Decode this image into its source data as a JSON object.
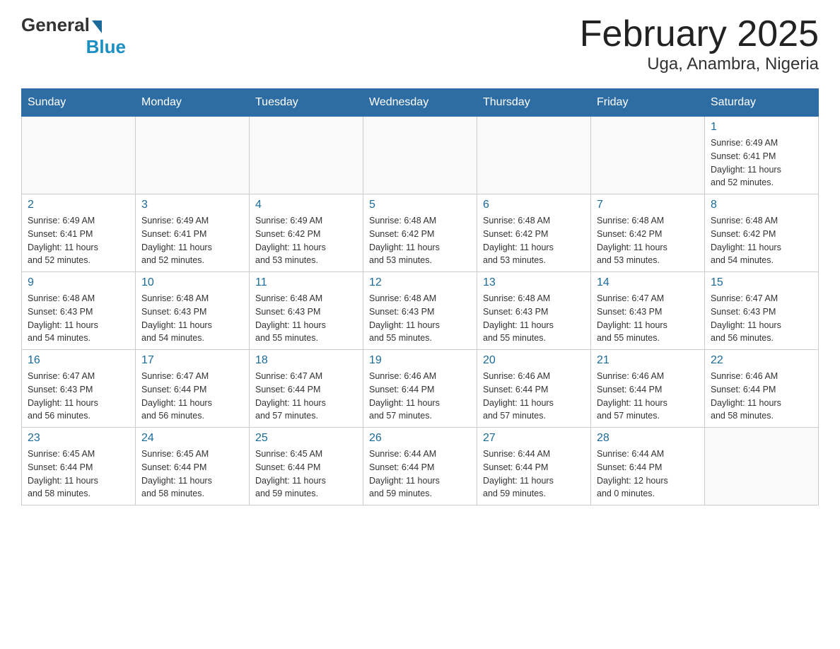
{
  "logo": {
    "general": "General",
    "blue": "Blue",
    "subtitle": "Blue"
  },
  "title": "February 2025",
  "location": "Uga, Anambra, Nigeria",
  "days_of_week": [
    "Sunday",
    "Monday",
    "Tuesday",
    "Wednesday",
    "Thursday",
    "Friday",
    "Saturday"
  ],
  "weeks": [
    [
      {
        "day": "",
        "info": ""
      },
      {
        "day": "",
        "info": ""
      },
      {
        "day": "",
        "info": ""
      },
      {
        "day": "",
        "info": ""
      },
      {
        "day": "",
        "info": ""
      },
      {
        "day": "",
        "info": ""
      },
      {
        "day": "1",
        "info": "Sunrise: 6:49 AM\nSunset: 6:41 PM\nDaylight: 11 hours\nand 52 minutes."
      }
    ],
    [
      {
        "day": "2",
        "info": "Sunrise: 6:49 AM\nSunset: 6:41 PM\nDaylight: 11 hours\nand 52 minutes."
      },
      {
        "day": "3",
        "info": "Sunrise: 6:49 AM\nSunset: 6:41 PM\nDaylight: 11 hours\nand 52 minutes."
      },
      {
        "day": "4",
        "info": "Sunrise: 6:49 AM\nSunset: 6:42 PM\nDaylight: 11 hours\nand 53 minutes."
      },
      {
        "day": "5",
        "info": "Sunrise: 6:48 AM\nSunset: 6:42 PM\nDaylight: 11 hours\nand 53 minutes."
      },
      {
        "day": "6",
        "info": "Sunrise: 6:48 AM\nSunset: 6:42 PM\nDaylight: 11 hours\nand 53 minutes."
      },
      {
        "day": "7",
        "info": "Sunrise: 6:48 AM\nSunset: 6:42 PM\nDaylight: 11 hours\nand 53 minutes."
      },
      {
        "day": "8",
        "info": "Sunrise: 6:48 AM\nSunset: 6:42 PM\nDaylight: 11 hours\nand 54 minutes."
      }
    ],
    [
      {
        "day": "9",
        "info": "Sunrise: 6:48 AM\nSunset: 6:43 PM\nDaylight: 11 hours\nand 54 minutes."
      },
      {
        "day": "10",
        "info": "Sunrise: 6:48 AM\nSunset: 6:43 PM\nDaylight: 11 hours\nand 54 minutes."
      },
      {
        "day": "11",
        "info": "Sunrise: 6:48 AM\nSunset: 6:43 PM\nDaylight: 11 hours\nand 55 minutes."
      },
      {
        "day": "12",
        "info": "Sunrise: 6:48 AM\nSunset: 6:43 PM\nDaylight: 11 hours\nand 55 minutes."
      },
      {
        "day": "13",
        "info": "Sunrise: 6:48 AM\nSunset: 6:43 PM\nDaylight: 11 hours\nand 55 minutes."
      },
      {
        "day": "14",
        "info": "Sunrise: 6:47 AM\nSunset: 6:43 PM\nDaylight: 11 hours\nand 55 minutes."
      },
      {
        "day": "15",
        "info": "Sunrise: 6:47 AM\nSunset: 6:43 PM\nDaylight: 11 hours\nand 56 minutes."
      }
    ],
    [
      {
        "day": "16",
        "info": "Sunrise: 6:47 AM\nSunset: 6:43 PM\nDaylight: 11 hours\nand 56 minutes."
      },
      {
        "day": "17",
        "info": "Sunrise: 6:47 AM\nSunset: 6:44 PM\nDaylight: 11 hours\nand 56 minutes."
      },
      {
        "day": "18",
        "info": "Sunrise: 6:47 AM\nSunset: 6:44 PM\nDaylight: 11 hours\nand 57 minutes."
      },
      {
        "day": "19",
        "info": "Sunrise: 6:46 AM\nSunset: 6:44 PM\nDaylight: 11 hours\nand 57 minutes."
      },
      {
        "day": "20",
        "info": "Sunrise: 6:46 AM\nSunset: 6:44 PM\nDaylight: 11 hours\nand 57 minutes."
      },
      {
        "day": "21",
        "info": "Sunrise: 6:46 AM\nSunset: 6:44 PM\nDaylight: 11 hours\nand 57 minutes."
      },
      {
        "day": "22",
        "info": "Sunrise: 6:46 AM\nSunset: 6:44 PM\nDaylight: 11 hours\nand 58 minutes."
      }
    ],
    [
      {
        "day": "23",
        "info": "Sunrise: 6:45 AM\nSunset: 6:44 PM\nDaylight: 11 hours\nand 58 minutes."
      },
      {
        "day": "24",
        "info": "Sunrise: 6:45 AM\nSunset: 6:44 PM\nDaylight: 11 hours\nand 58 minutes."
      },
      {
        "day": "25",
        "info": "Sunrise: 6:45 AM\nSunset: 6:44 PM\nDaylight: 11 hours\nand 59 minutes."
      },
      {
        "day": "26",
        "info": "Sunrise: 6:44 AM\nSunset: 6:44 PM\nDaylight: 11 hours\nand 59 minutes."
      },
      {
        "day": "27",
        "info": "Sunrise: 6:44 AM\nSunset: 6:44 PM\nDaylight: 11 hours\nand 59 minutes."
      },
      {
        "day": "28",
        "info": "Sunrise: 6:44 AM\nSunset: 6:44 PM\nDaylight: 12 hours\nand 0 minutes."
      },
      {
        "day": "",
        "info": ""
      }
    ]
  ]
}
